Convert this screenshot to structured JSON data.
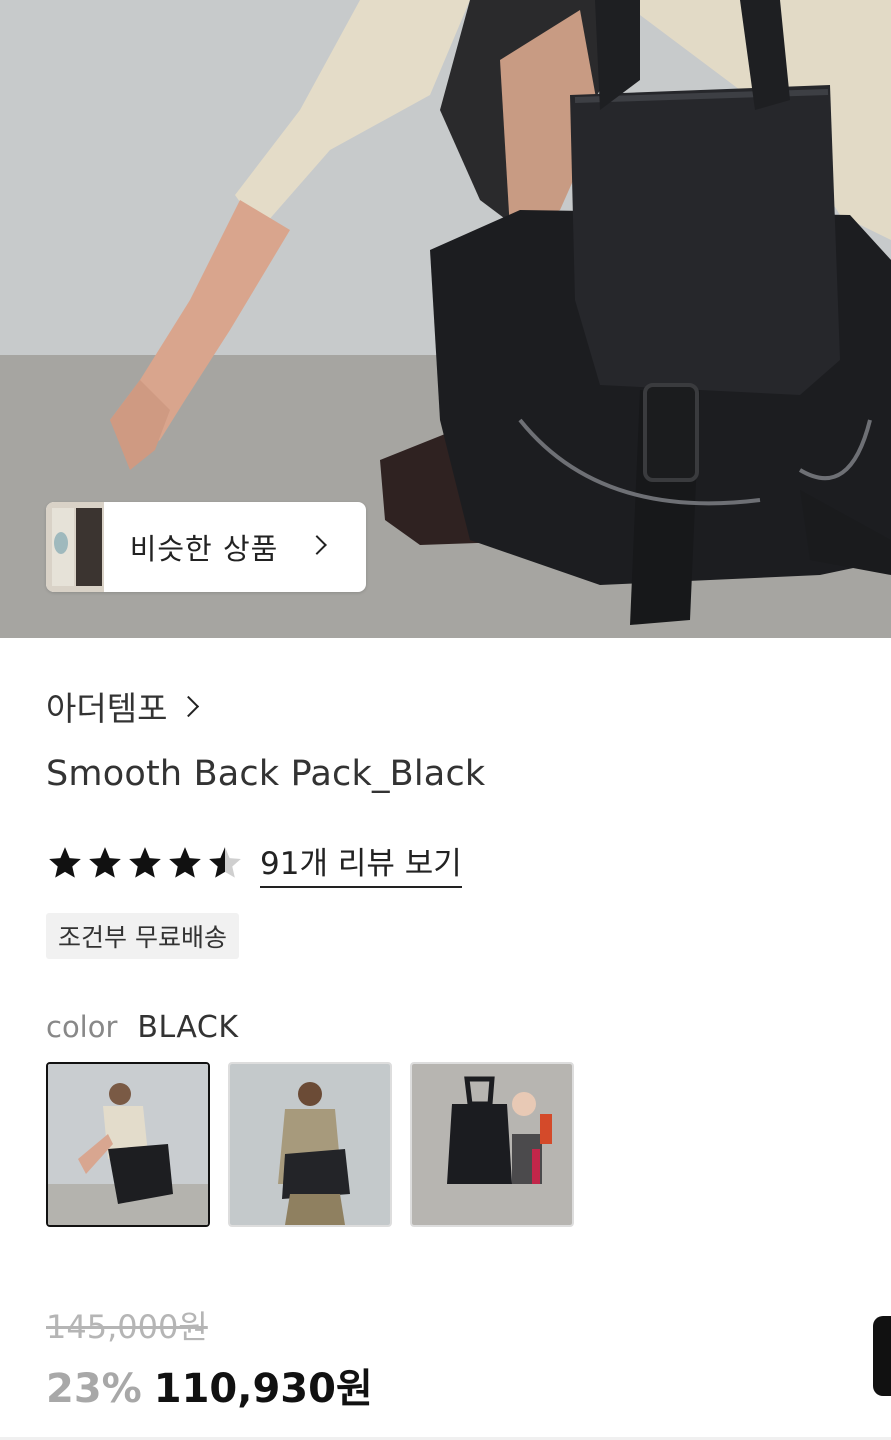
{
  "hero": {
    "image_name": "backpack-hero-photo",
    "similar_button": {
      "label": "비슷한 상품",
      "icon": "chevron-right-icon"
    }
  },
  "product": {
    "brand": "아더템포",
    "brand_icon": "chevron-right-icon",
    "title": "Smooth Back Pack_Black",
    "rating": {
      "value": 4.5,
      "max": 5,
      "review_link": "91개 리뷰 보기"
    },
    "shipping_badge": "조건부 무료배송",
    "color": {
      "label": "color",
      "value": "BLACK"
    },
    "thumbnails": [
      {
        "name": "model-crouching",
        "selected": true
      },
      {
        "name": "model-standing",
        "selected": false
      },
      {
        "name": "bag-flatlay",
        "selected": false
      }
    ],
    "price": {
      "original": "145,000원",
      "discount": "23%",
      "sale": "110,930원"
    }
  }
}
